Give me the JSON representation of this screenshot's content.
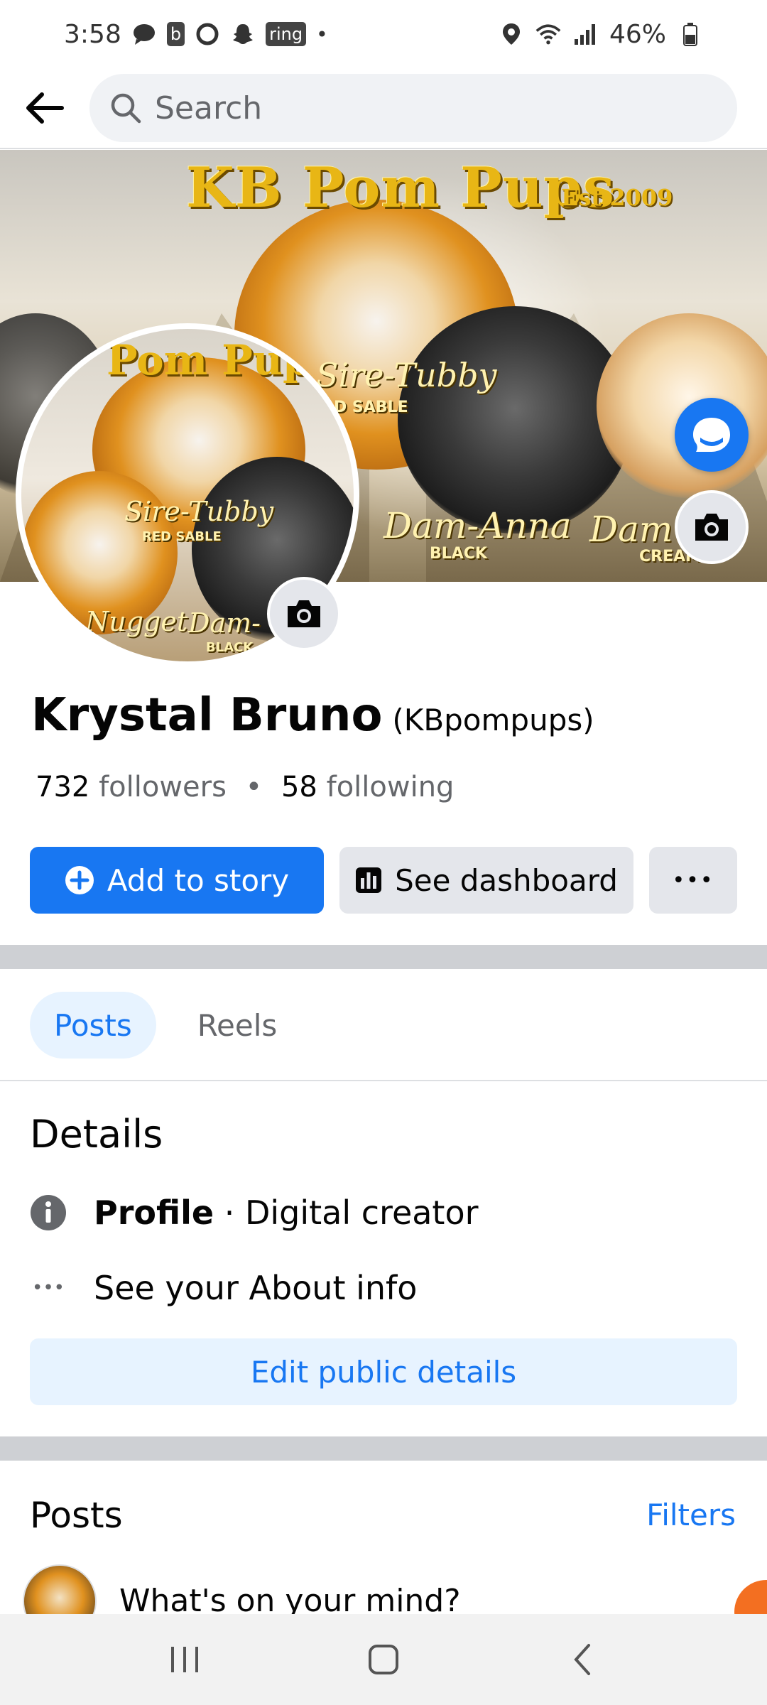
{
  "status_bar": {
    "time": "3:58",
    "battery": "46%",
    "icons": [
      "chat-bubble-icon",
      "b-icon",
      "ring-circle-icon",
      "snapchat-icon",
      "ring-app-icon",
      "dot",
      "location-icon",
      "wifi-icon",
      "signal-icon",
      "battery-icon"
    ],
    "ring_label": "ring",
    "b_label": "b"
  },
  "header": {
    "back_icon": "arrow-left-icon",
    "search_placeholder": "Search"
  },
  "cover": {
    "title": "KB Pom Pups",
    "est": "Est 2009",
    "labels": {
      "sire": "Sire-Tubby",
      "sire_sub": "D SABLE",
      "dam_anna": "Dam-Anna",
      "dam_anna_sub": "BLACK",
      "dam_cream": "Dam",
      "dam_cream_sub": "CREAM"
    }
  },
  "avatar": {
    "title": "Pom Pup",
    "sire": "Sire-Tubby",
    "sire_sub": "RED SABLE",
    "nugget": "Nugget",
    "dam": "Dam-",
    "dam_sub": "BLACK"
  },
  "profile": {
    "name": "Krystal Bruno",
    "username": "(KBpompups)",
    "followers_count": "732",
    "followers_label": "followers",
    "separator": "•",
    "following_count": "58",
    "following_label": "following"
  },
  "actions": {
    "add_story": "Add to story",
    "dashboard": "See dashboard",
    "more": "•••"
  },
  "tabs": [
    {
      "label": "Posts",
      "active": true
    },
    {
      "label": "Reels",
      "active": false
    }
  ],
  "details": {
    "title": "Details",
    "profile_bold": "Profile",
    "profile_rest": " · Digital creator",
    "about_icon": "•••",
    "about": "See your About info",
    "edit": "Edit public details"
  },
  "posts": {
    "title": "Posts",
    "filters": "Filters",
    "composer_placeholder": "What's on your mind?"
  },
  "colors": {
    "accent": "#1877f2",
    "light_accent": "#e7f3ff",
    "secondary_bg": "#e4e6eb",
    "divider": "#ced0d4"
  }
}
